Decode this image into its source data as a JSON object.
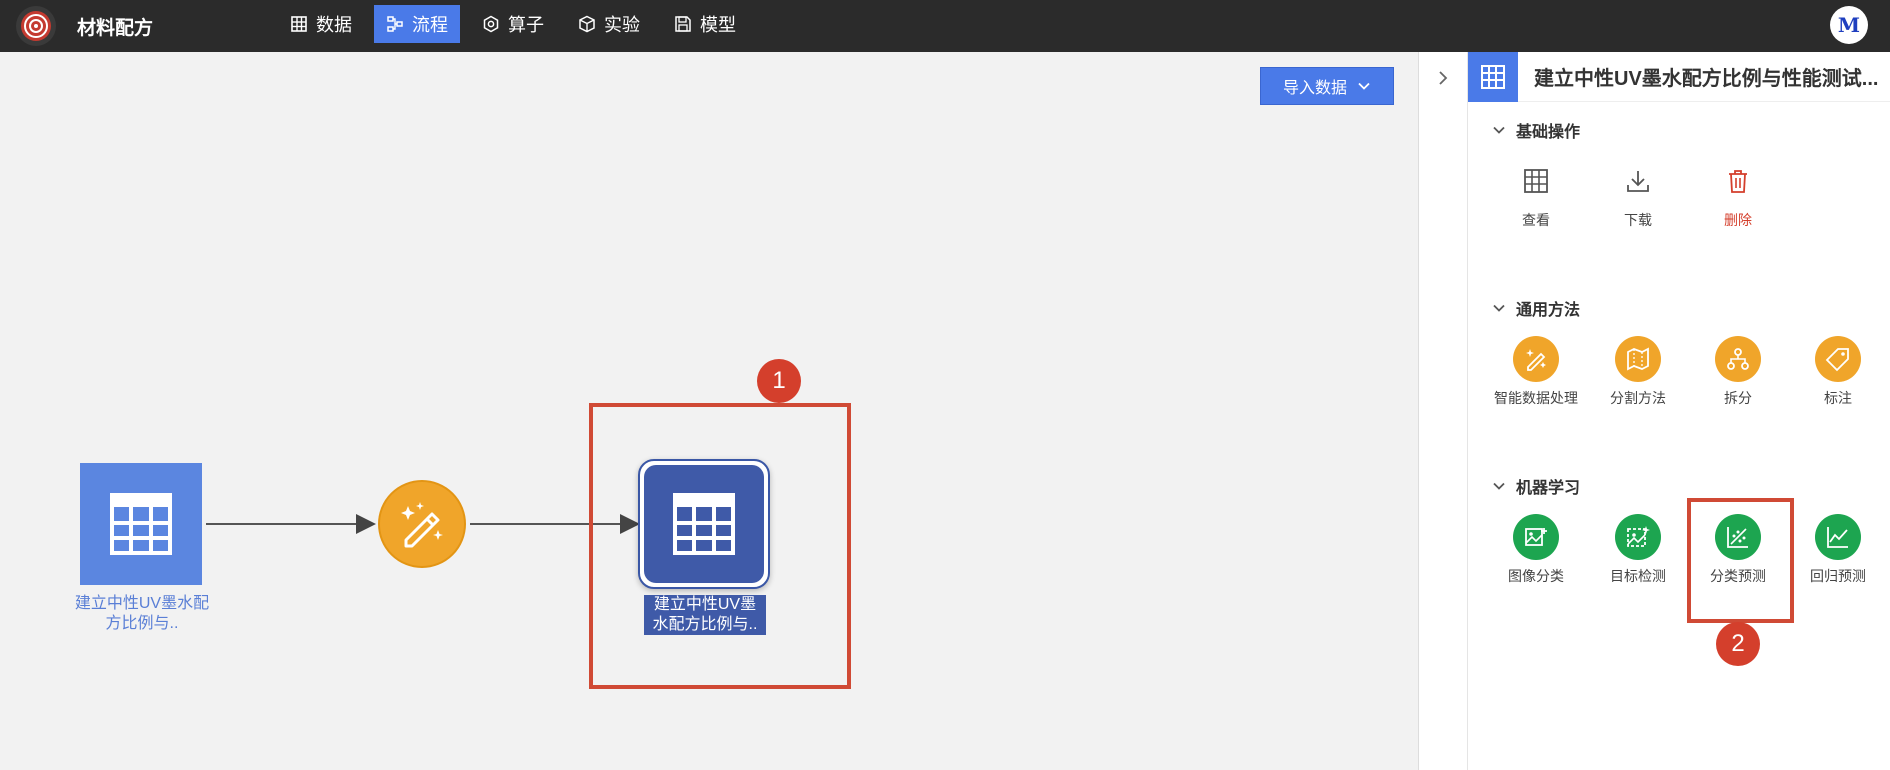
{
  "app": {
    "title": "材料配方",
    "avatar_letter": "M"
  },
  "nav": [
    {
      "label": "数据",
      "icon": "table-icon",
      "active": false
    },
    {
      "label": "流程",
      "icon": "workflow-icon",
      "active": true
    },
    {
      "label": "算子",
      "icon": "operator-icon",
      "active": false
    },
    {
      "label": "实验",
      "icon": "cube-icon",
      "active": false
    },
    {
      "label": "模型",
      "icon": "save-icon",
      "active": false
    }
  ],
  "canvas": {
    "import_button": "导入数据",
    "node1_label": "建立中性UV墨水配方比例与..",
    "node3_label": "建立中性UV墨水配方比例与..",
    "badge1": "1",
    "badge2": "2"
  },
  "panel": {
    "title": "建立中性UV墨水配方比例与性能测试...",
    "sections": [
      {
        "title": "基础操作",
        "tools": [
          "查看",
          "下载",
          "删除"
        ]
      },
      {
        "title": "通用方法",
        "tools": [
          "智能数据处理",
          "分割方法",
          "拆分",
          "标注"
        ]
      },
      {
        "title": "机器学习",
        "tools": [
          "图像分类",
          "目标检测",
          "分类预测",
          "回归预测"
        ]
      }
    ]
  },
  "colors": {
    "accent": "#4a7ae8",
    "orange": "#f0a52a",
    "green": "#1da550",
    "danger": "#d43f2c",
    "highlight": "#d04a35"
  }
}
